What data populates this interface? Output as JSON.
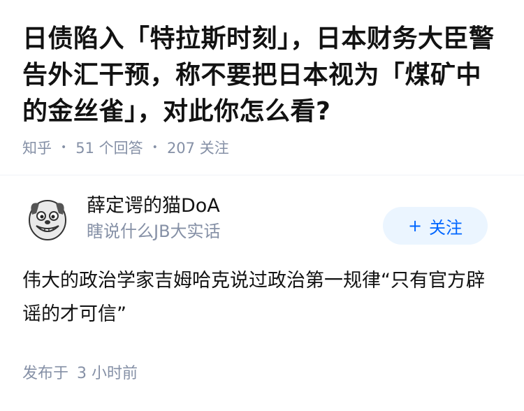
{
  "question": {
    "title": "日债陷入「特拉斯时刻」，日本财务大臣警告外汇干预，称不要把日本视为「煤矿中的金丝雀」，对此你怎么看?",
    "source": "知乎",
    "answer_count": "51 个回答",
    "follow_count": "207 关注"
  },
  "answer": {
    "author_name": "薛定谔的猫DoA",
    "author_headline": "瞎说什么JB大实话",
    "follow_label": "关注",
    "follow_icon": "plus-icon",
    "content": "伟大的政治学家吉姆哈克说过政治第一规律“只有官方辟谣的才可信”",
    "published_label": "发布于",
    "published_time": "3 小时前"
  },
  "colors": {
    "accent": "#0066ff",
    "accent_bg": "#ebf5ff",
    "muted": "#8590a6",
    "text": "#121212"
  }
}
